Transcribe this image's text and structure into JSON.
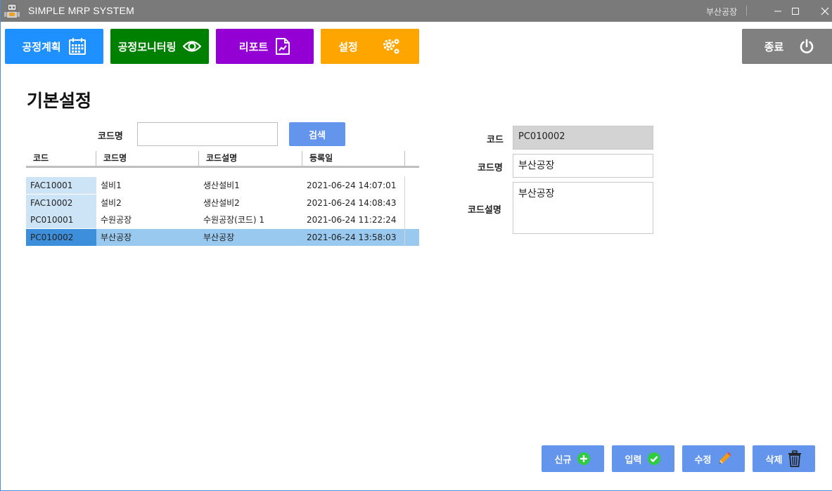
{
  "window": {
    "title": "SIMPLE MRP SYSTEM",
    "current_user": "부산공장"
  },
  "nav": {
    "plan_label": "공정계획",
    "monitor_label": "공정모니터링",
    "report_label": "리포트",
    "settings_label": "설정",
    "exit_label": "종료"
  },
  "page": {
    "title": "기본설정"
  },
  "search": {
    "label": "코드명",
    "value": "",
    "button_label": "검색"
  },
  "grid": {
    "columns": [
      "코드",
      "코드명",
      "코드설명",
      "등록일"
    ],
    "rows": [
      {
        "code": "FAC10001",
        "name": "설비1",
        "desc": "생산설비1",
        "date": "2021-06-24 14:07:01"
      },
      {
        "code": "FAC10002",
        "name": "설비2",
        "desc": "생산설비2",
        "date": "2021-06-24 14:08:43"
      },
      {
        "code": "PC010001",
        "name": "수원공장",
        "desc": "수원공장(코드) 1",
        "date": "2021-06-24 11:22:24"
      },
      {
        "code": "PC010002",
        "name": "부산공장",
        "desc": "부산공장",
        "date": "2021-06-24 13:58:03"
      }
    ],
    "selected_row": 3
  },
  "detail": {
    "code_label": "코드",
    "code_value": "PC010002",
    "name_label": "코드명",
    "name_value": "부산공장",
    "desc_label": "코드설명",
    "desc_value": "부산공장"
  },
  "actions": {
    "new_label": "신규",
    "save_label": "입력",
    "edit_label": "수정",
    "delete_label": "삭제"
  },
  "colors": {
    "plan": "#1e90ff",
    "monitor": "#008000",
    "report": "#9400d3",
    "settings": "#ffa500",
    "exit": "#808080",
    "action": "#6495ed",
    "selection": "#99c9ef"
  },
  "icons": {
    "plan": "calendar-icon",
    "monitor": "eye-icon",
    "report": "report-file-icon",
    "settings": "gears-icon",
    "exit": "power-icon",
    "new": "plus-circle-icon",
    "save": "check-circle-icon",
    "edit": "pencil-icon",
    "delete": "trash-icon"
  }
}
